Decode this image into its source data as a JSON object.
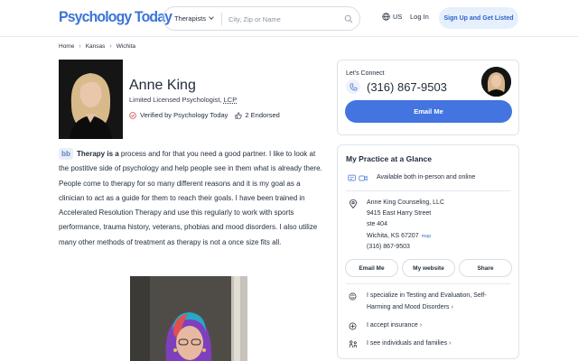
{
  "header": {
    "logo": "Psychology Today",
    "search_category": "Therapists",
    "search_placeholder": "City, Zip or Name",
    "language": "US",
    "login": "Log In",
    "signup": "Sign Up and Get Listed"
  },
  "breadcrumb": [
    "Home",
    "Kansas",
    "Wichita"
  ],
  "profile": {
    "name": "Anne King",
    "title_prefix": "Limited Licensed Psychologist, ",
    "title_abbrev": "LCP",
    "verified": "Verified by Psychology Today",
    "endorsed": "2 Endorsed",
    "about_lead": "Therapy is a",
    "about_body": " process and for that you need a good partner. I like to look at the postitive side of psychology and help people see in them what is already there. People come to therapy for so many different reasons and it is my goal as a clinician to act as a guide for them to reach their goals. I have been trained in Accelerated Resolution Therapy and use this regularly to work with sports performance, trauma history, veterans, phobias and mood disorders. I also utilize many other methods of treatment as therapy is not a once size fits all."
  },
  "connect": {
    "label": "Let's Connect",
    "phone": "(316) 867-9503",
    "email_button": "Email Me"
  },
  "practice": {
    "title": "My Practice at a Glance",
    "availability": "Available both in-person and online",
    "practice_name": "Anne King Counseling, LLC",
    "street": "9415 East Harry Street",
    "suite": "ste 404",
    "city": "Wichita, KS 67207",
    "map_label": "map",
    "phone": "(316) 867-9503",
    "buttons": [
      "Email Me",
      "My website",
      "Share"
    ],
    "specialty_line1": "I specialize in Testing and Evaluation, Self-",
    "specialty_line2": "Harming and Mood Disorders",
    "insurance": "I accept insurance",
    "clients": "I see individuals and families"
  },
  "colors": {
    "brand": "#3a74d8",
    "primary_button": "#4374e0",
    "signup_bg": "#e6effc"
  }
}
